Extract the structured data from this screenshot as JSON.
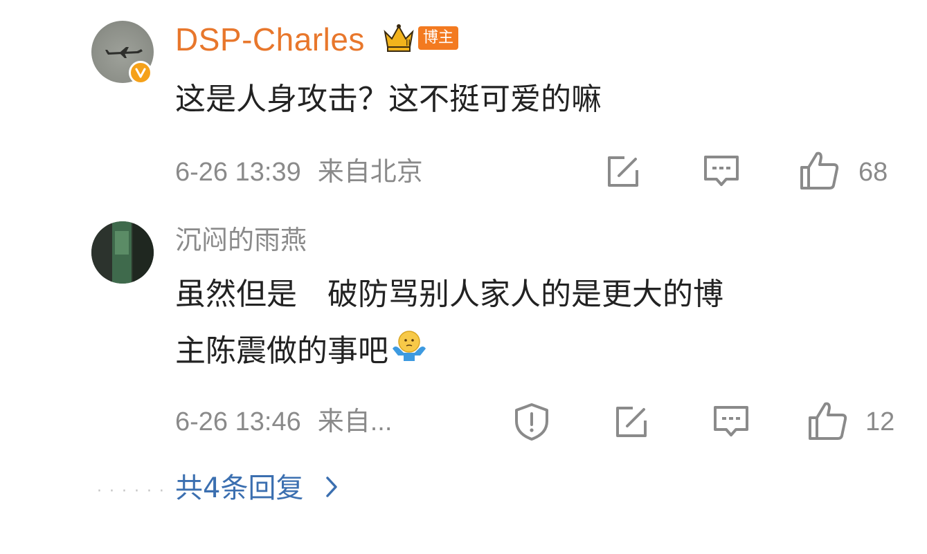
{
  "comments": [
    {
      "username": "DSP-Charles",
      "badge": "博主",
      "text": "这是人身攻击？这不挺可爱的嘛",
      "time": "6-26 13:39",
      "location": "来自北京",
      "likes": "68"
    },
    {
      "username": "沉闷的雨燕",
      "text_lines": [
        "虽然但是　破防骂别人家人的是更大的博",
        "主陈震做的事吧"
      ],
      "time": "6-26 13:46",
      "location": "来自...",
      "likes": "12"
    }
  ],
  "replies_link": "共4条回复",
  "colors": {
    "username_orange": "#e8772c",
    "link_blue": "#3b6fb0",
    "meta_gray": "#8a8a8a",
    "badge_orange": "#f37a20"
  },
  "icons": [
    "verified-badge-icon",
    "crown-icon",
    "edit-share-icon",
    "comment-icon",
    "like-icon",
    "report-shield-icon",
    "chevron-right-icon",
    "shrug-emoji-icon"
  ]
}
